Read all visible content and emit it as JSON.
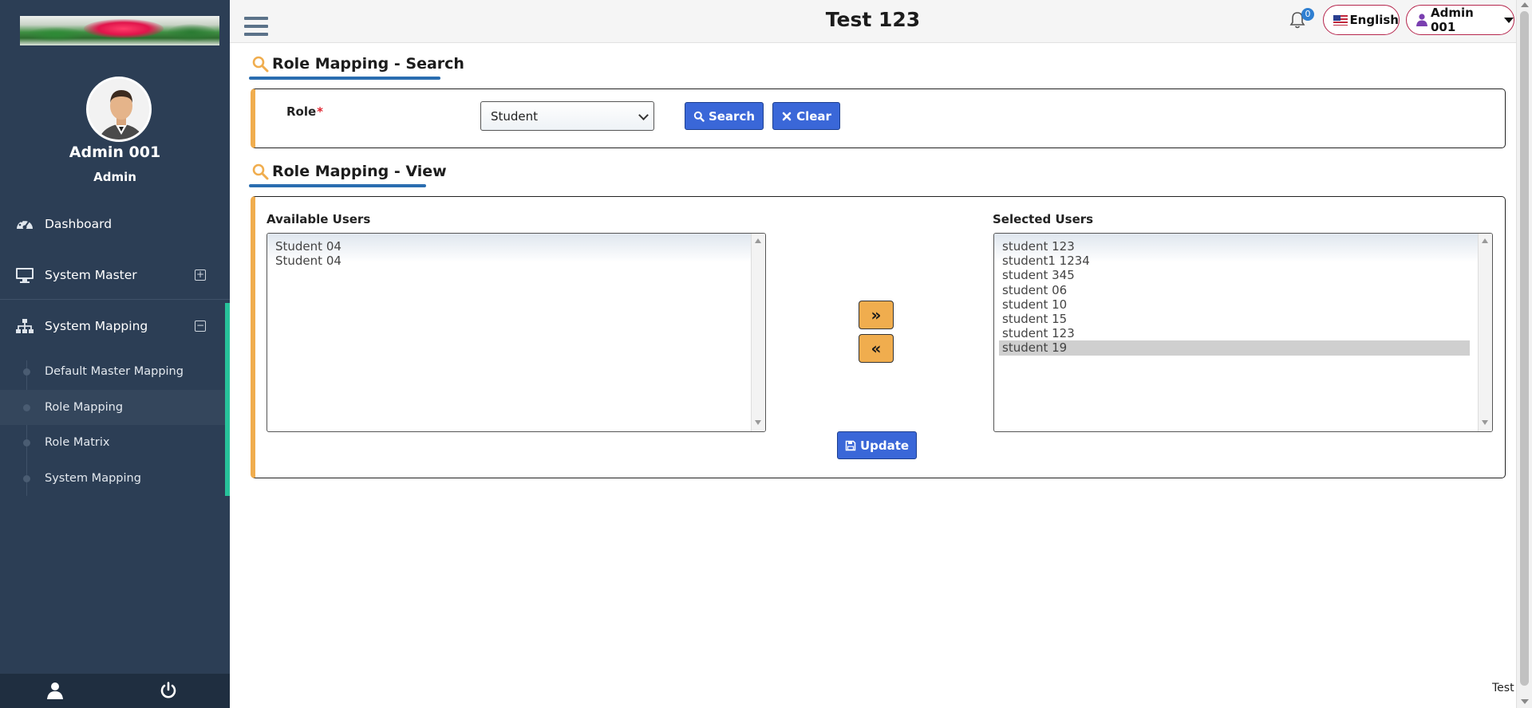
{
  "app": {
    "title": "Test 123"
  },
  "header": {
    "notification_count": "0",
    "language": "English",
    "user_menu": "Admin 001"
  },
  "sidebar": {
    "profile": {
      "name": "Admin 001",
      "role": "Admin"
    },
    "nav": [
      {
        "label": "Dashboard",
        "icon": "dashboard-icon"
      },
      {
        "label": "System Master",
        "icon": "monitor-icon",
        "toggle": "+"
      },
      {
        "label": "System Mapping",
        "icon": "sitemap-icon",
        "toggle": "−"
      }
    ],
    "submenu": [
      {
        "label": "Default Master Mapping"
      },
      {
        "label": "Role Mapping",
        "active": true
      },
      {
        "label": "Role Matrix"
      },
      {
        "label": "System Mapping"
      }
    ],
    "accent_color": "#27c29a"
  },
  "search_section": {
    "title": "Role Mapping - Search",
    "role_label": "Role",
    "required_mark": "*",
    "role_value": "Student",
    "search_label": "Search",
    "clear_label": "Clear"
  },
  "view_section": {
    "title": "Role Mapping - View",
    "available_label": "Available Users",
    "selected_label": "Selected Users",
    "available_users": [
      "Student 04",
      "Student 04"
    ],
    "selected_users": [
      "student 123",
      "student1 1234",
      "student 345",
      "student 06",
      "student 10",
      "student 15",
      "student 123",
      "student 19"
    ],
    "selected_highlight_index": 7,
    "move_right_label": "»",
    "move_left_label": "«",
    "update_label": "Update"
  },
  "footer": {
    "text": "Test"
  },
  "colors": {
    "primary_button": "#3a67d8",
    "accent_orange": "#f0ad4e",
    "sidebar_bg": "#2c3e55",
    "heading_underline": "#2a6db0"
  }
}
